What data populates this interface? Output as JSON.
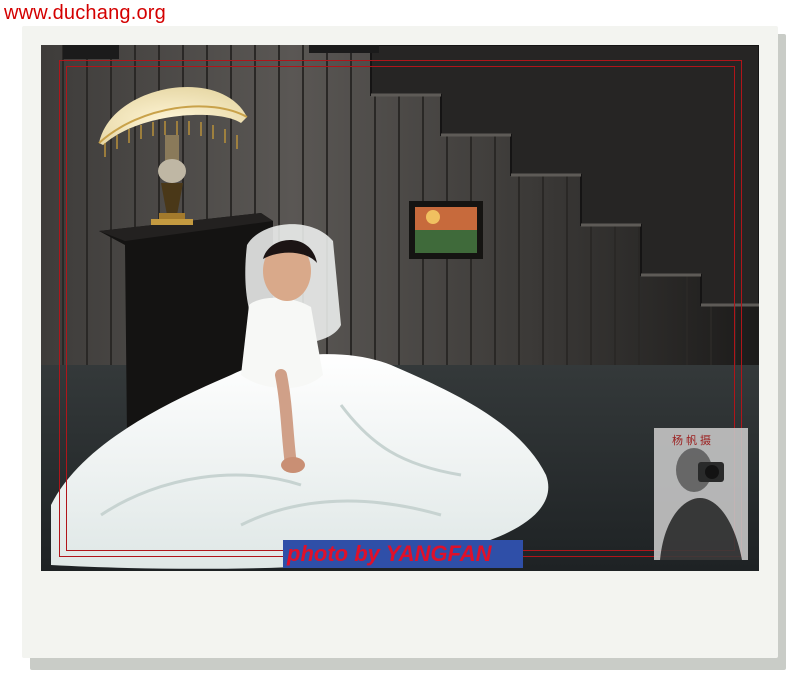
{
  "watermark": {
    "site_url": "www.duchang.org",
    "color": "#d40000"
  },
  "photo": {
    "subject": "bride-in-white-gown",
    "caption": "photo by YANGFAN",
    "caption_color": "#e0102a",
    "caption_bg": "#2f4fa8",
    "frame_color": "#b0151a"
  },
  "photographer_portrait": {
    "name_stamp": "杨帆摄"
  },
  "colors": {
    "paper": "#f3f4f0",
    "shadow": "#c9ccc7",
    "wall": "#4a4744"
  }
}
